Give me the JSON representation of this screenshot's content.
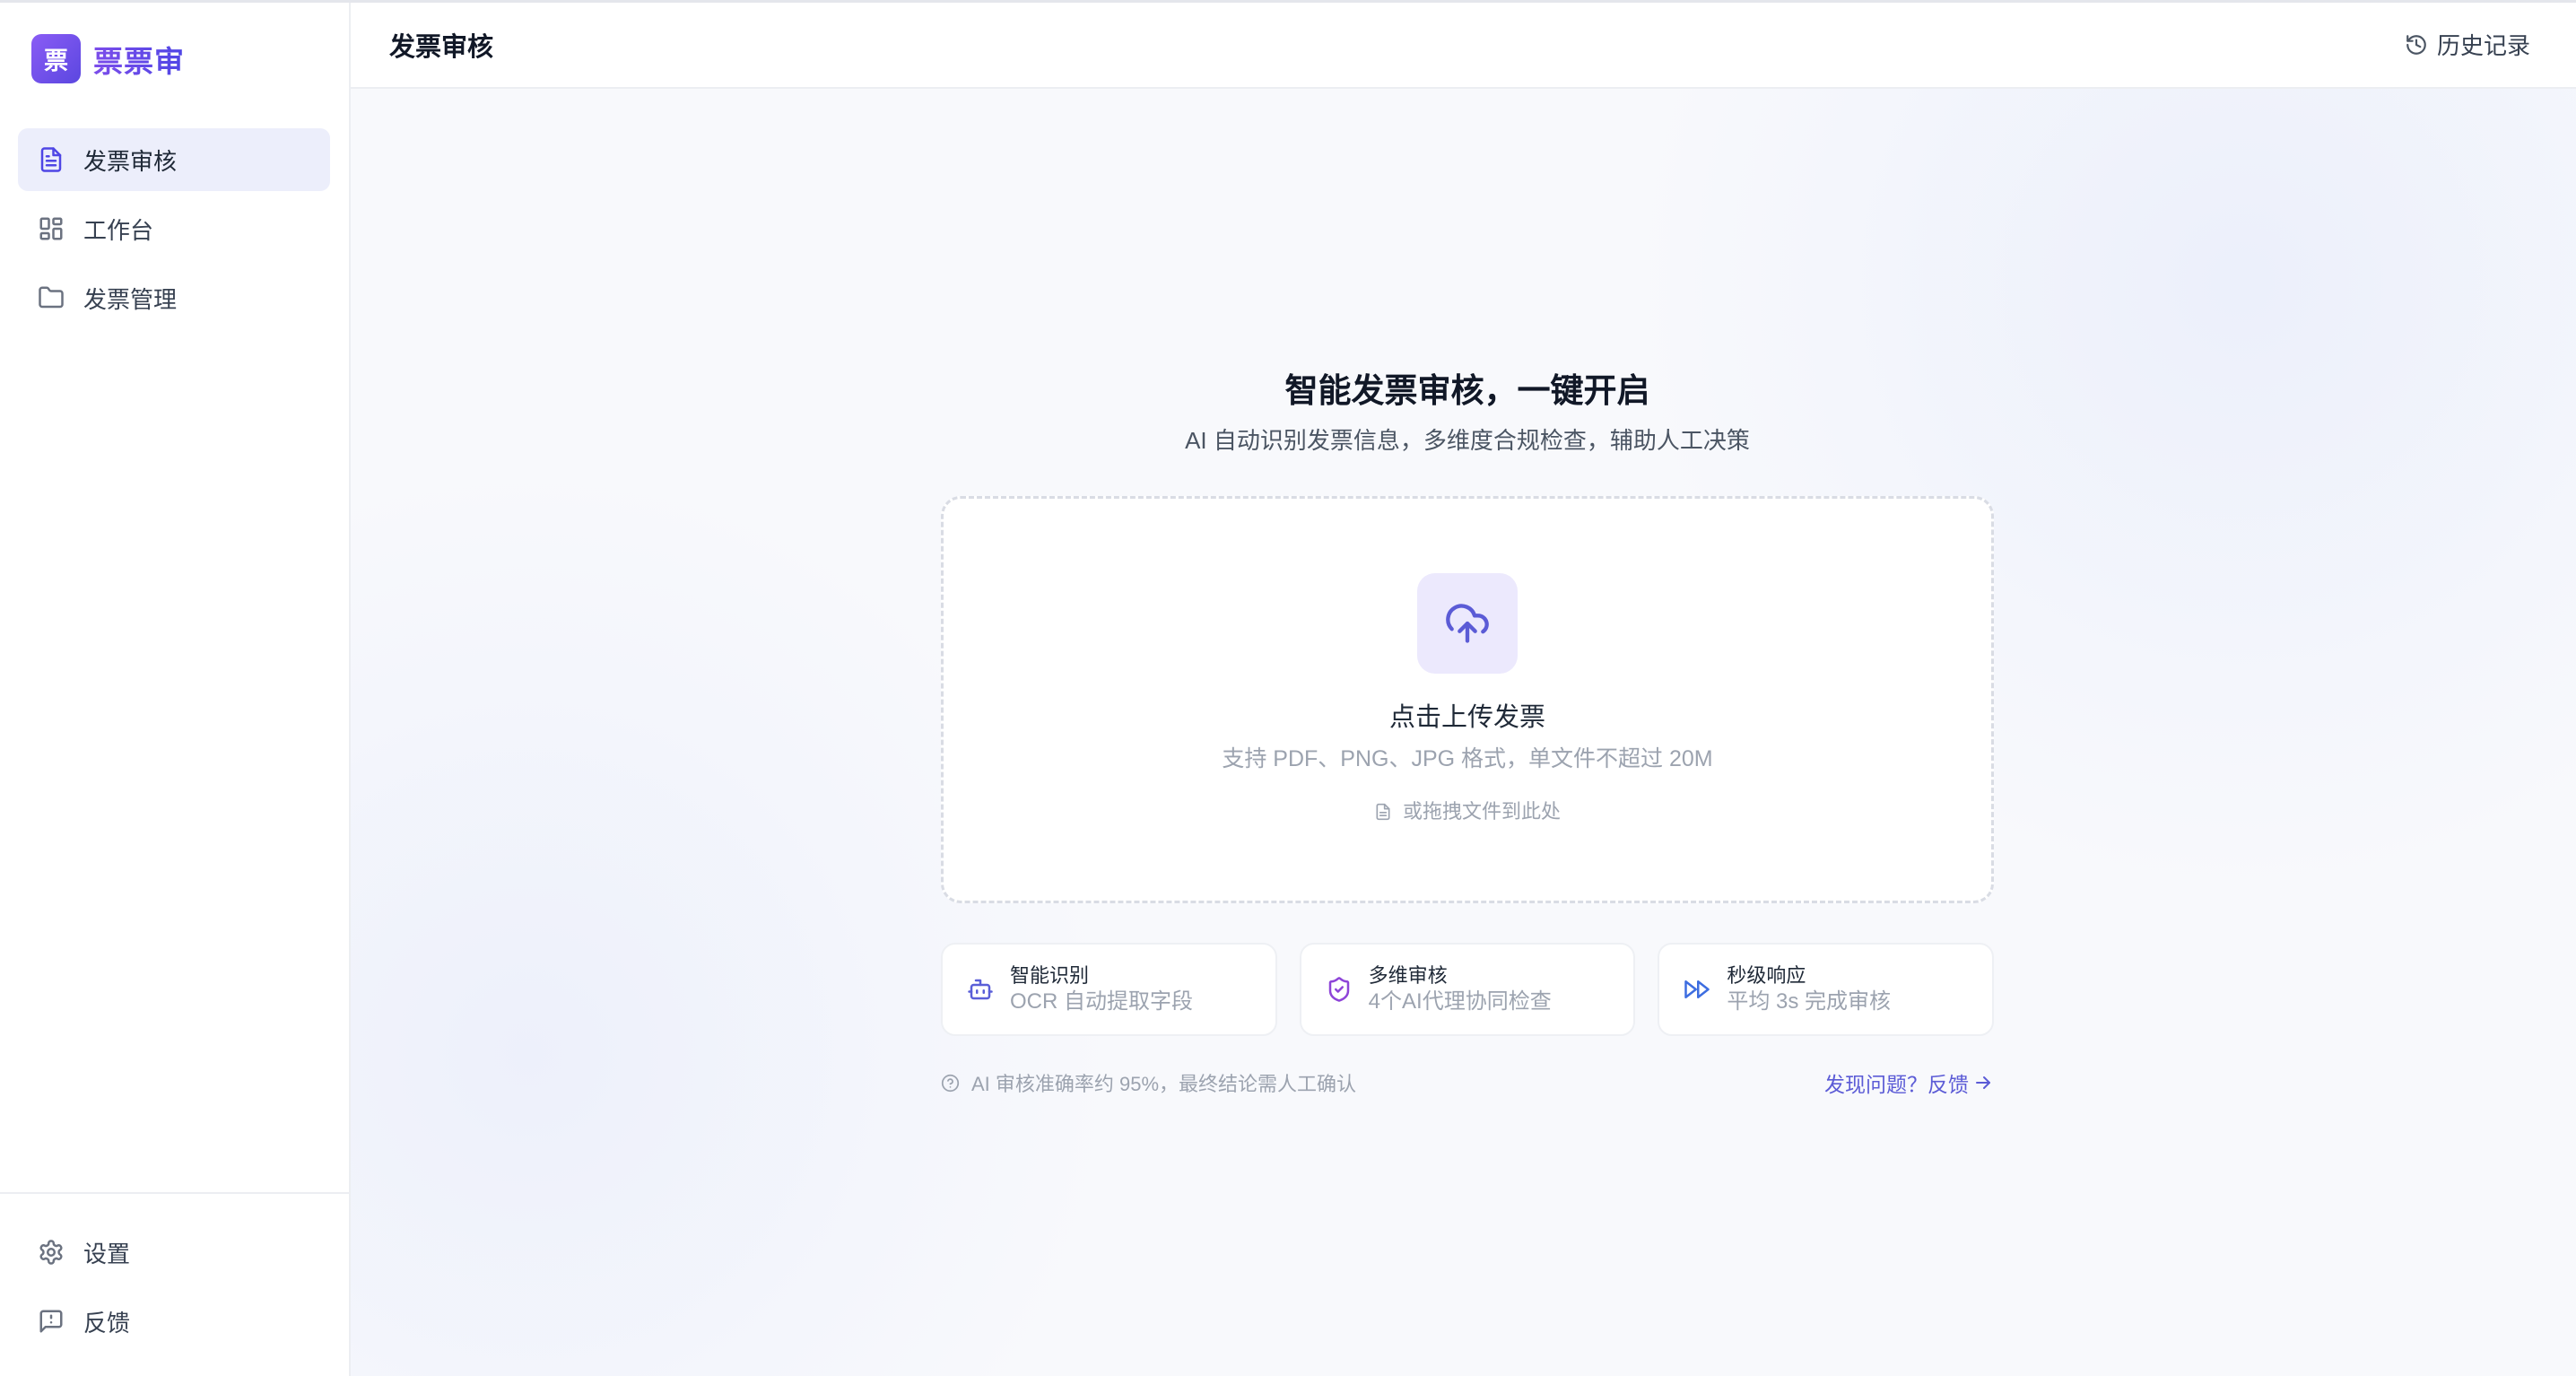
{
  "app": {
    "name": "票票审",
    "logo_char": "票"
  },
  "sidebar": {
    "nav": [
      {
        "label": "发票审核",
        "icon": "document-icon",
        "active": true
      },
      {
        "label": "工作台",
        "icon": "grid-icon",
        "active": false
      },
      {
        "label": "发票管理",
        "icon": "folder-icon",
        "active": false
      }
    ],
    "bottom": [
      {
        "label": "设置",
        "icon": "gear-icon"
      },
      {
        "label": "反馈",
        "icon": "feedback-icon"
      }
    ]
  },
  "header": {
    "title": "发票审核",
    "history_label": "历史记录",
    "history_icon": "history-icon"
  },
  "hero": {
    "title": "智能发票审核，一键开启",
    "subtitle": "AI 自动识别发票信息，多维度合规检查，辅助人工决策"
  },
  "upload": {
    "icon": "cloud-upload-icon",
    "title": "点击上传发票",
    "hint": "支持 PDF、PNG、JPG 格式，单文件不超过 20M",
    "drag_hint": "或拖拽文件到此处",
    "drag_icon": "file-icon"
  },
  "features": [
    {
      "title": "智能识别",
      "desc": "OCR 自动提取字段",
      "icon": "robot-icon"
    },
    {
      "title": "多维审核",
      "desc": "4个AI代理协同检查",
      "icon": "shield-check-icon"
    },
    {
      "title": "秒级响应",
      "desc": "平均 3s 完成审核",
      "icon": "fast-forward-icon"
    }
  ],
  "footer": {
    "note": "AI 审核准确率约 95%，最终结论需人工确认",
    "note_icon": "help-circle-icon",
    "feedback_link": "发现问题？反馈",
    "link_icon": "arrow-right-icon"
  },
  "colors": {
    "accent": "#5b5bd6",
    "logo_start": "#8a5cf5",
    "logo_end": "#5b47e0",
    "active_bg": "#eceefb",
    "upload_icon_bg": "#ece9fd",
    "feature_robot": "#5a5fd8",
    "feature_shield": "#8e44d8",
    "feature_speed": "#3d6de0",
    "text_primary": "#1f2937",
    "text_muted": "#9ca3af"
  }
}
